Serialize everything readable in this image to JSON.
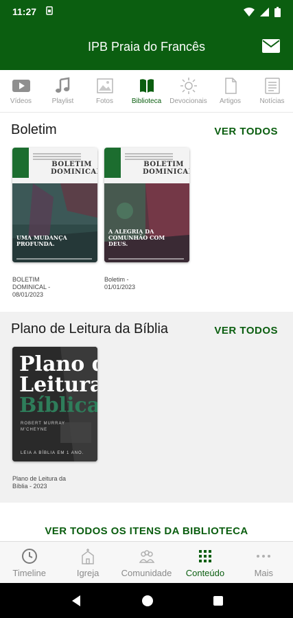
{
  "status": {
    "time": "11:27",
    "sim_icon": "sim-icon",
    "icons": [
      "wifi-icon",
      "signal-icon",
      "battery-icon"
    ]
  },
  "header": {
    "title": "IPB Praia do Francês",
    "mail_icon": "mail-icon"
  },
  "colors": {
    "brand": "#0b5e10",
    "inactive": "#9a9a9a"
  },
  "tabs": [
    {
      "label": "Vídeos",
      "icon": "video-icon",
      "active": false
    },
    {
      "label": "Playlist",
      "icon": "music-note-icon",
      "active": false
    },
    {
      "label": "Fotos",
      "icon": "photo-icon",
      "active": false
    },
    {
      "label": "Biblioteca",
      "icon": "book-icon",
      "active": true
    },
    {
      "label": "Devocionais",
      "icon": "sun-icon",
      "active": false
    },
    {
      "label": "Artigos",
      "icon": "document-icon",
      "active": false
    },
    {
      "label": "Notícias",
      "icon": "news-icon",
      "active": false
    }
  ],
  "boletim": {
    "title": "Boletim",
    "see_all": "VER TODOS",
    "items": [
      {
        "caption": "BOLETIM DOMINICAL - 08/01/2023",
        "cover_title": "BOLETIM DOMINICAL",
        "cover_headline": "UMA MUDANÇA PROFUNDA."
      },
      {
        "caption": "Boletim - 01/01/2023",
        "cover_title": "BOLETIM DOMINICAL",
        "cover_headline": "A ALEGRIA DA COMUNHÃO COM DEUS."
      }
    ]
  },
  "plano": {
    "title": "Plano de Leitura da Bíblia",
    "see_all": "VER TODOS",
    "items": [
      {
        "caption": "Plano de Leitura da Bíblia - 2023",
        "cover_line1": "Plano de",
        "cover_line2": "Leitura",
        "cover_line3": "Bíblica.",
        "cover_author": "ROBERT MURRAY M'CHEYNE",
        "cover_sub": "LEIA A BÍBLIA EM 1 ANO."
      }
    ]
  },
  "all_items": "VER TODOS OS ITENS DA BIBLIOTECA",
  "bottom_nav": [
    {
      "label": "Timeline",
      "icon": "clock-icon",
      "active": false
    },
    {
      "label": "Igreja",
      "icon": "church-icon",
      "active": false
    },
    {
      "label": "Comunidade",
      "icon": "community-icon",
      "active": false
    },
    {
      "label": "Conteúdo",
      "icon": "grid-icon",
      "active": true
    },
    {
      "label": "Mais",
      "icon": "more-dots-icon",
      "active": false
    }
  ]
}
